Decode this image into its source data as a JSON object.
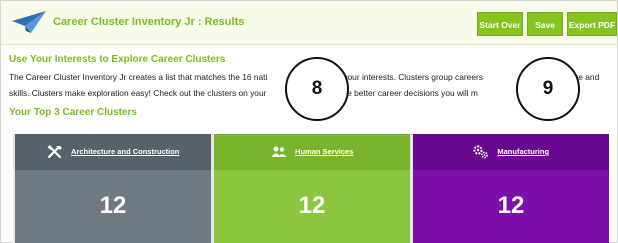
{
  "header": {
    "app_title": "Career Cluster Inventory Jr : Results",
    "buttons": {
      "start_over": "Start Over",
      "save": "Save",
      "export_pdf": "Export PDF"
    }
  },
  "interests": {
    "heading": "Use Your Interests to Explore Career Clusters",
    "intro_line_1": "The Career Cluster Inventory Jr creates a list that matches the 16 nati",
    "intro_line_1b": "to your interests. Clusters group careers",
    "intro_line_1c": "ge and",
    "intro_line_2": "skills. Clusters make exploration easy! Check out the clusters on your",
    "intro_line_2b": "ow the better career decisions you will m"
  },
  "callouts": [
    {
      "number": "8"
    },
    {
      "number": "9"
    }
  ],
  "top_clusters": {
    "heading": "Your Top 3 Career Clusters",
    "clusters": [
      {
        "title": "Architecture and Construction",
        "score": "12",
        "icon": "tools-icon",
        "color": "#6e7a82"
      },
      {
        "title": "Human Services",
        "score": "12",
        "icon": "people-icon",
        "color": "#8cc63f"
      },
      {
        "title": "Manufacturing",
        "score": "12",
        "icon": "gears-icon",
        "color": "#7c0fa8"
      }
    ]
  }
}
